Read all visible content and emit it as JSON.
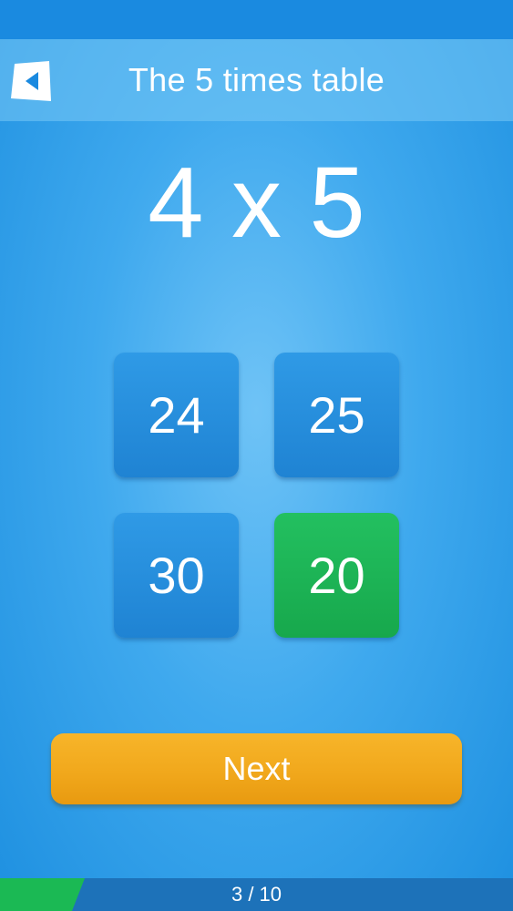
{
  "header": {
    "title": "The 5 times table",
    "back_icon": "back-arrow-icon"
  },
  "question": {
    "text": "4 x 5"
  },
  "answers": [
    {
      "label": "24",
      "state": "default"
    },
    {
      "label": "25",
      "state": "default"
    },
    {
      "label": "30",
      "state": "default"
    },
    {
      "label": "20",
      "state": "correct"
    }
  ],
  "next_button": {
    "label": "Next"
  },
  "progress": {
    "label": "3 / 10",
    "current": 3,
    "total": 10
  },
  "colors": {
    "background": "#3fa9ee",
    "answer_tile": "#2f9ae6",
    "correct_tile": "#1fb55a",
    "next_button": "#f1a81c",
    "progress_fill": "#1bb954",
    "progress_track": "#1d72b9"
  }
}
